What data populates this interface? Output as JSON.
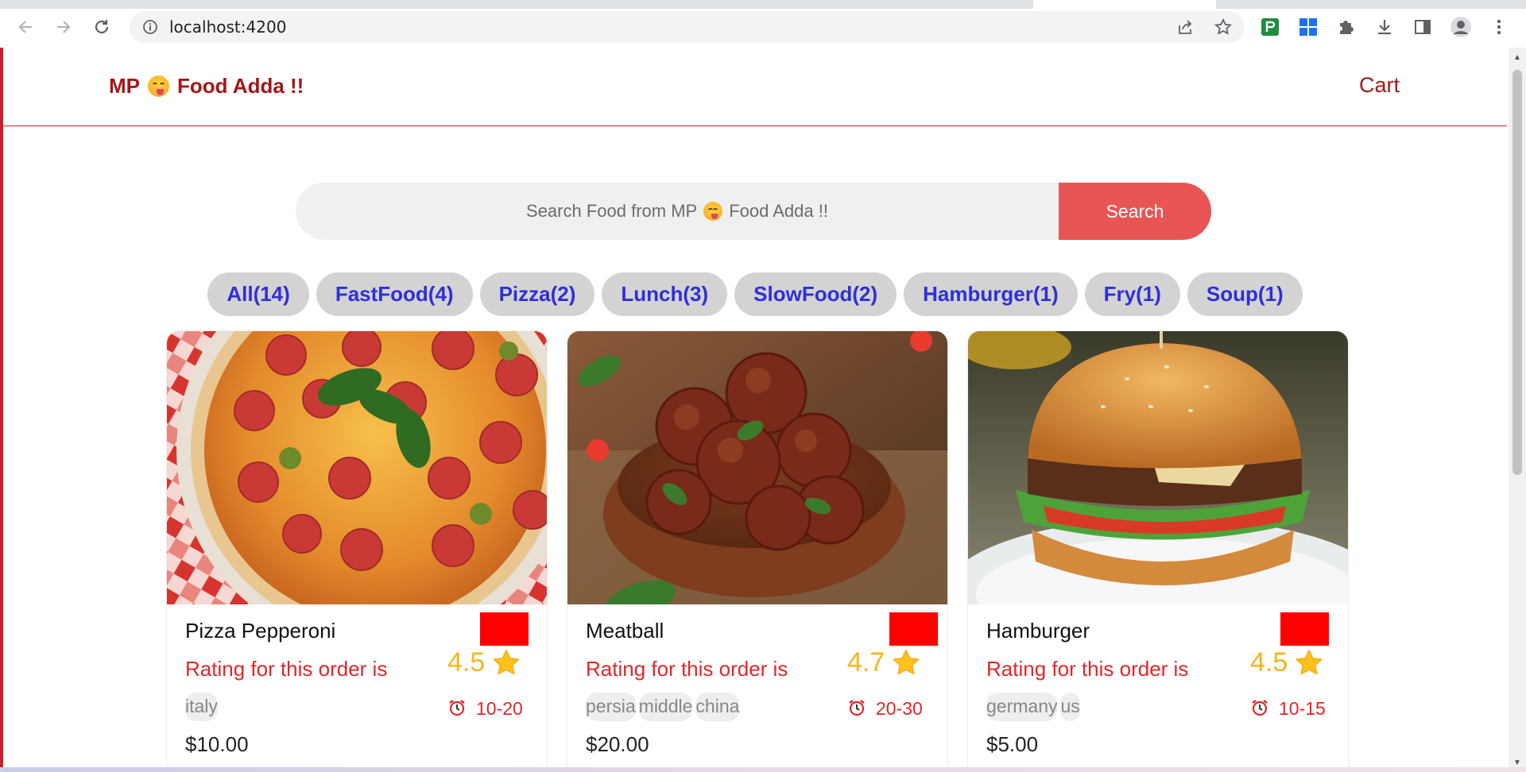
{
  "browser": {
    "url": "localhost:4200"
  },
  "header": {
    "logo_left": "MP",
    "logo_right": "Food Adda !!",
    "cart_label": "Cart"
  },
  "search": {
    "placeholder_left": "Search Food from MP",
    "placeholder_right": "Food Adda !!",
    "button_label": "Search"
  },
  "tags": [
    {
      "label": "All(14)"
    },
    {
      "label": "FastFood(4)"
    },
    {
      "label": "Pizza(2)"
    },
    {
      "label": "Lunch(3)"
    },
    {
      "label": "SlowFood(2)"
    },
    {
      "label": "Hamburger(1)"
    },
    {
      "label": "Fry(1)"
    },
    {
      "label": "Soup(1)"
    }
  ],
  "foods": [
    {
      "name": "Pizza Pepperoni",
      "rating_label": "Rating for this order is",
      "rating": "4.5",
      "origins": [
        "italy"
      ],
      "cook_time": "10-20",
      "price": "$10.00"
    },
    {
      "name": "Meatball",
      "rating_label": "Rating for this order is",
      "rating": "4.7",
      "origins": [
        "persia",
        "middle",
        "china"
      ],
      "cook_time": "20-30",
      "price": "$20.00"
    },
    {
      "name": "Hamburger",
      "rating_label": "Rating for this order is",
      "rating": "4.5",
      "origins": [
        "germany",
        "us"
      ],
      "cook_time": "10-15",
      "price": "$5.00"
    }
  ],
  "colors": {
    "brand": "#a3171b",
    "search_button": "#e85555",
    "tag_text": "#2f2fd8",
    "rating": "#f7b51c",
    "favorite": "#ff0000"
  }
}
